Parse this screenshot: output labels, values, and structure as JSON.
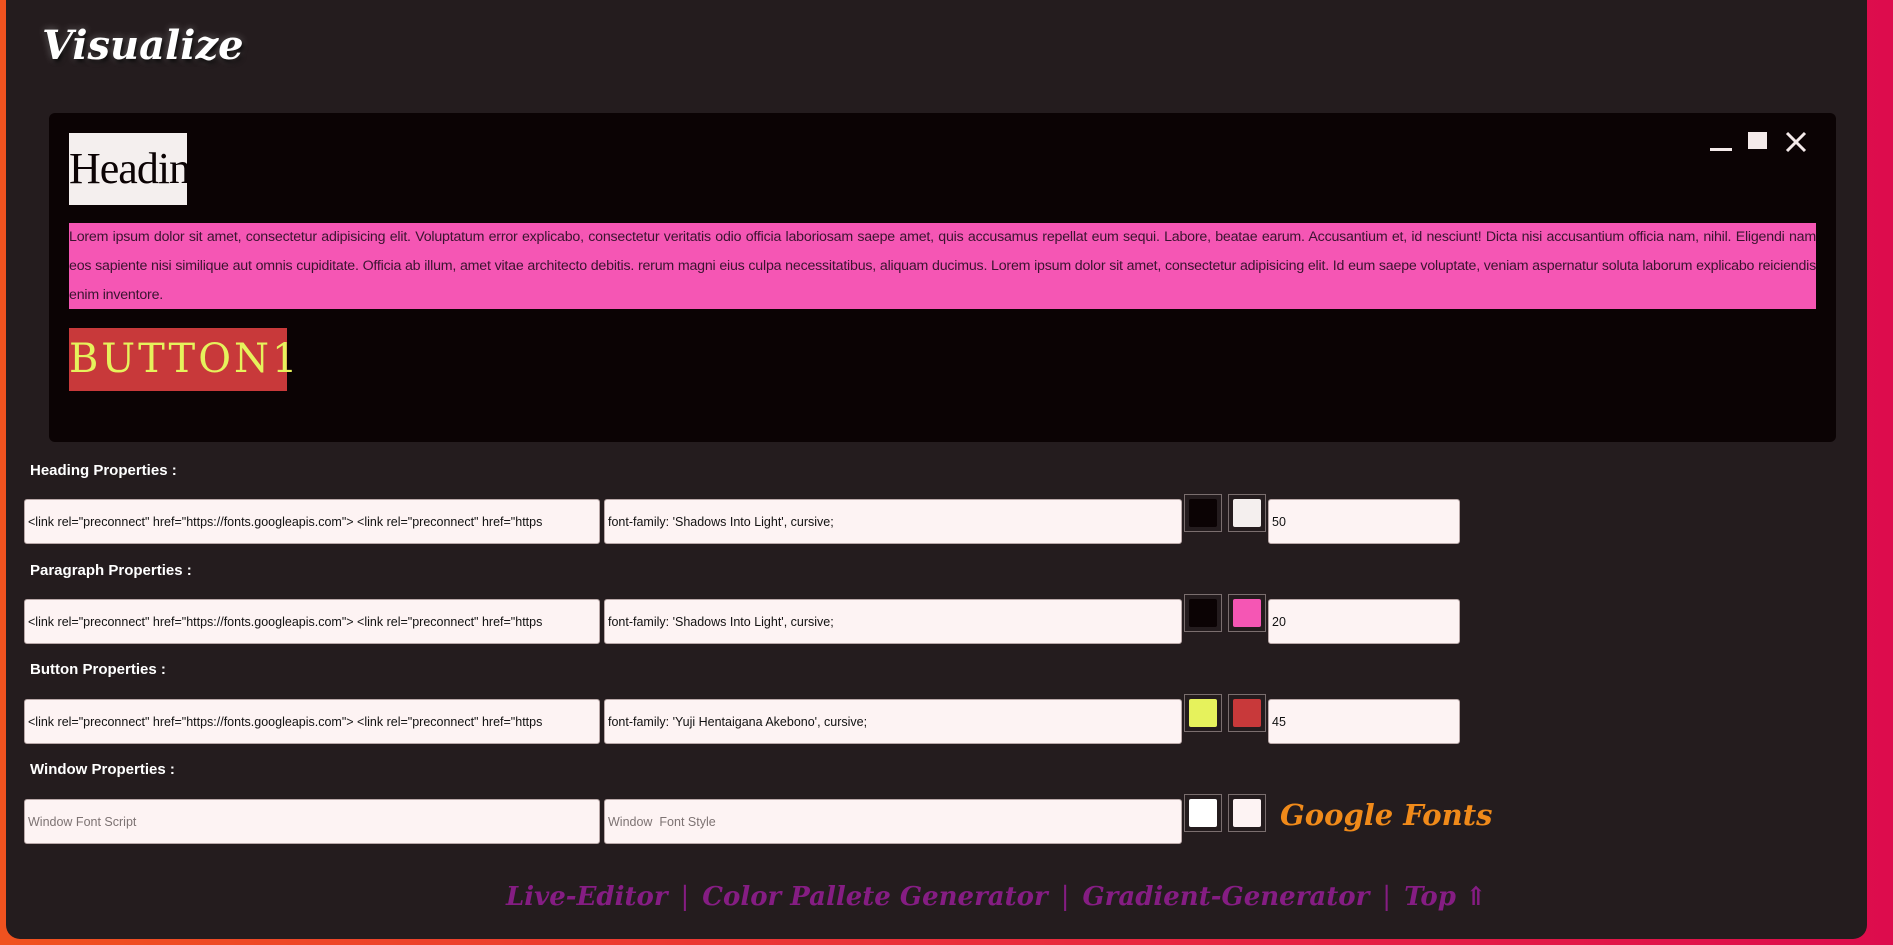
{
  "app": {
    "brand": "Visualize"
  },
  "preview": {
    "heading": "Heading",
    "paragraph": "Lorem ipsum dolor sit amet, consectetur adipisicing elit. Voluptatum error explicabo, consectetur veritatis odio officia laboriosam saepe amet, quis accusamus repellat eum sequi. Labore, beatae earum. Accusantium et, id nesciunt! Dicta nisi accusantium officia nam, nihil. Eligendi nam eos sapiente nisi similique aut omnis cupiditate. Officia ab illum, amet vitae architecto debitis. rerum magni eius culpa necessitatibus, aliquam ducimus. Lorem ipsum dolor sit amet, consectetur adipisicing elit. Id eum saepe voluptate, veniam aspernatur soluta laborum explicabo reiciendis enim inventore.",
    "button": "BUTTON1",
    "controls": {
      "minimize": "minimize-icon",
      "maximize": "maximize-icon",
      "close": "close-icon"
    }
  },
  "sections": {
    "heading": {
      "label": "Heading Properties :",
      "script": "<link rel=\"preconnect\" href=\"https://fonts.googleapis.com\"> <link rel=\"preconnect\" href=\"https",
      "style": "font-family: 'Shadows Into Light', cursive;",
      "bg_color": "#0b0304",
      "text_color": "#f4efee",
      "size": "50"
    },
    "paragraph": {
      "label": "Paragraph Properties :",
      "script": "<link rel=\"preconnect\" href=\"https://fonts.googleapis.com\"> <link rel=\"preconnect\" href=\"https",
      "style": "font-family: 'Shadows Into Light', cursive;",
      "bg_color": "#0b0304",
      "text_color": "#f556b4",
      "size": "20"
    },
    "button": {
      "label": "Button Properties :",
      "script": "<link rel=\"preconnect\" href=\"https://fonts.googleapis.com\"> <link rel=\"preconnect\" href=\"https",
      "style": "font-family: 'Yuji Hentaigana Akebono', cursive;",
      "bg_color": "#e6f25c",
      "text_color": "#c8393a",
      "size": "45"
    },
    "window": {
      "label": "Window Properties :",
      "script_placeholder": "Window Font Script",
      "style_placeholder": "Window  Font Style",
      "bg_color": "#ffffff",
      "text_color": "#fdf3f3",
      "link": "Google Fonts"
    }
  },
  "footer": {
    "links": [
      "Live-Editor",
      "Color Pallete Generator",
      "Gradient-Generator",
      "Top ⇑"
    ],
    "separator": "|"
  }
}
